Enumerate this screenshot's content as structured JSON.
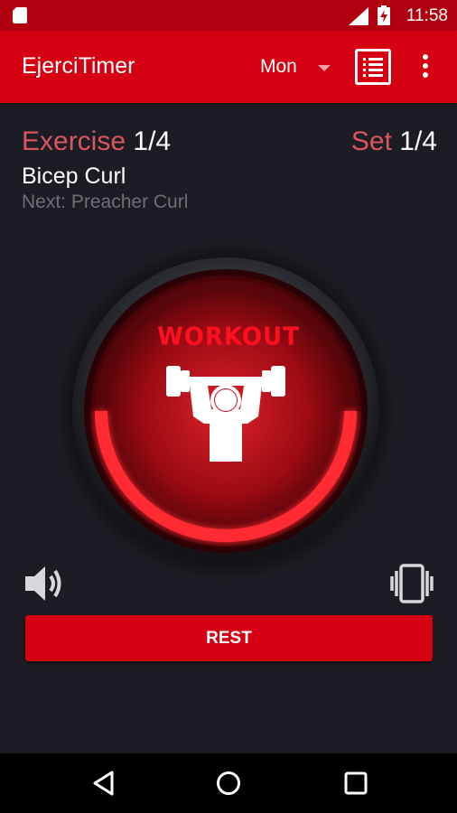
{
  "status_bar": {
    "time": "11:58",
    "icons": [
      "sd-card-icon",
      "signal-icon",
      "battery-charging-icon"
    ]
  },
  "app_bar": {
    "title": "EjerciTimer",
    "day_selector": {
      "selected": "Mon"
    },
    "actions": [
      "list-icon",
      "overflow-menu-icon"
    ]
  },
  "progress": {
    "exercise_word": "Exercise",
    "exercise_count": "1/4",
    "set_word": "Set",
    "set_count": "1/4"
  },
  "exercise": {
    "current": "Bicep Curl",
    "next": "Next: Preacher Curl"
  },
  "timer": {
    "state_label": "WORKOUT",
    "icon": "weightlifter-icon",
    "ring_progress": 0.5
  },
  "controls": {
    "sound_icon": "speaker-icon",
    "vibrate_icon": "vibrate-icon",
    "rest_button": "REST"
  },
  "nav_bar": [
    "back-icon",
    "home-icon",
    "recents-icon"
  ],
  "colors": {
    "accent": "#d50012",
    "status_bar": "#b00010",
    "background": "#1c1d24",
    "label_red": "#d9555f",
    "muted_text": "#6e6f76"
  }
}
